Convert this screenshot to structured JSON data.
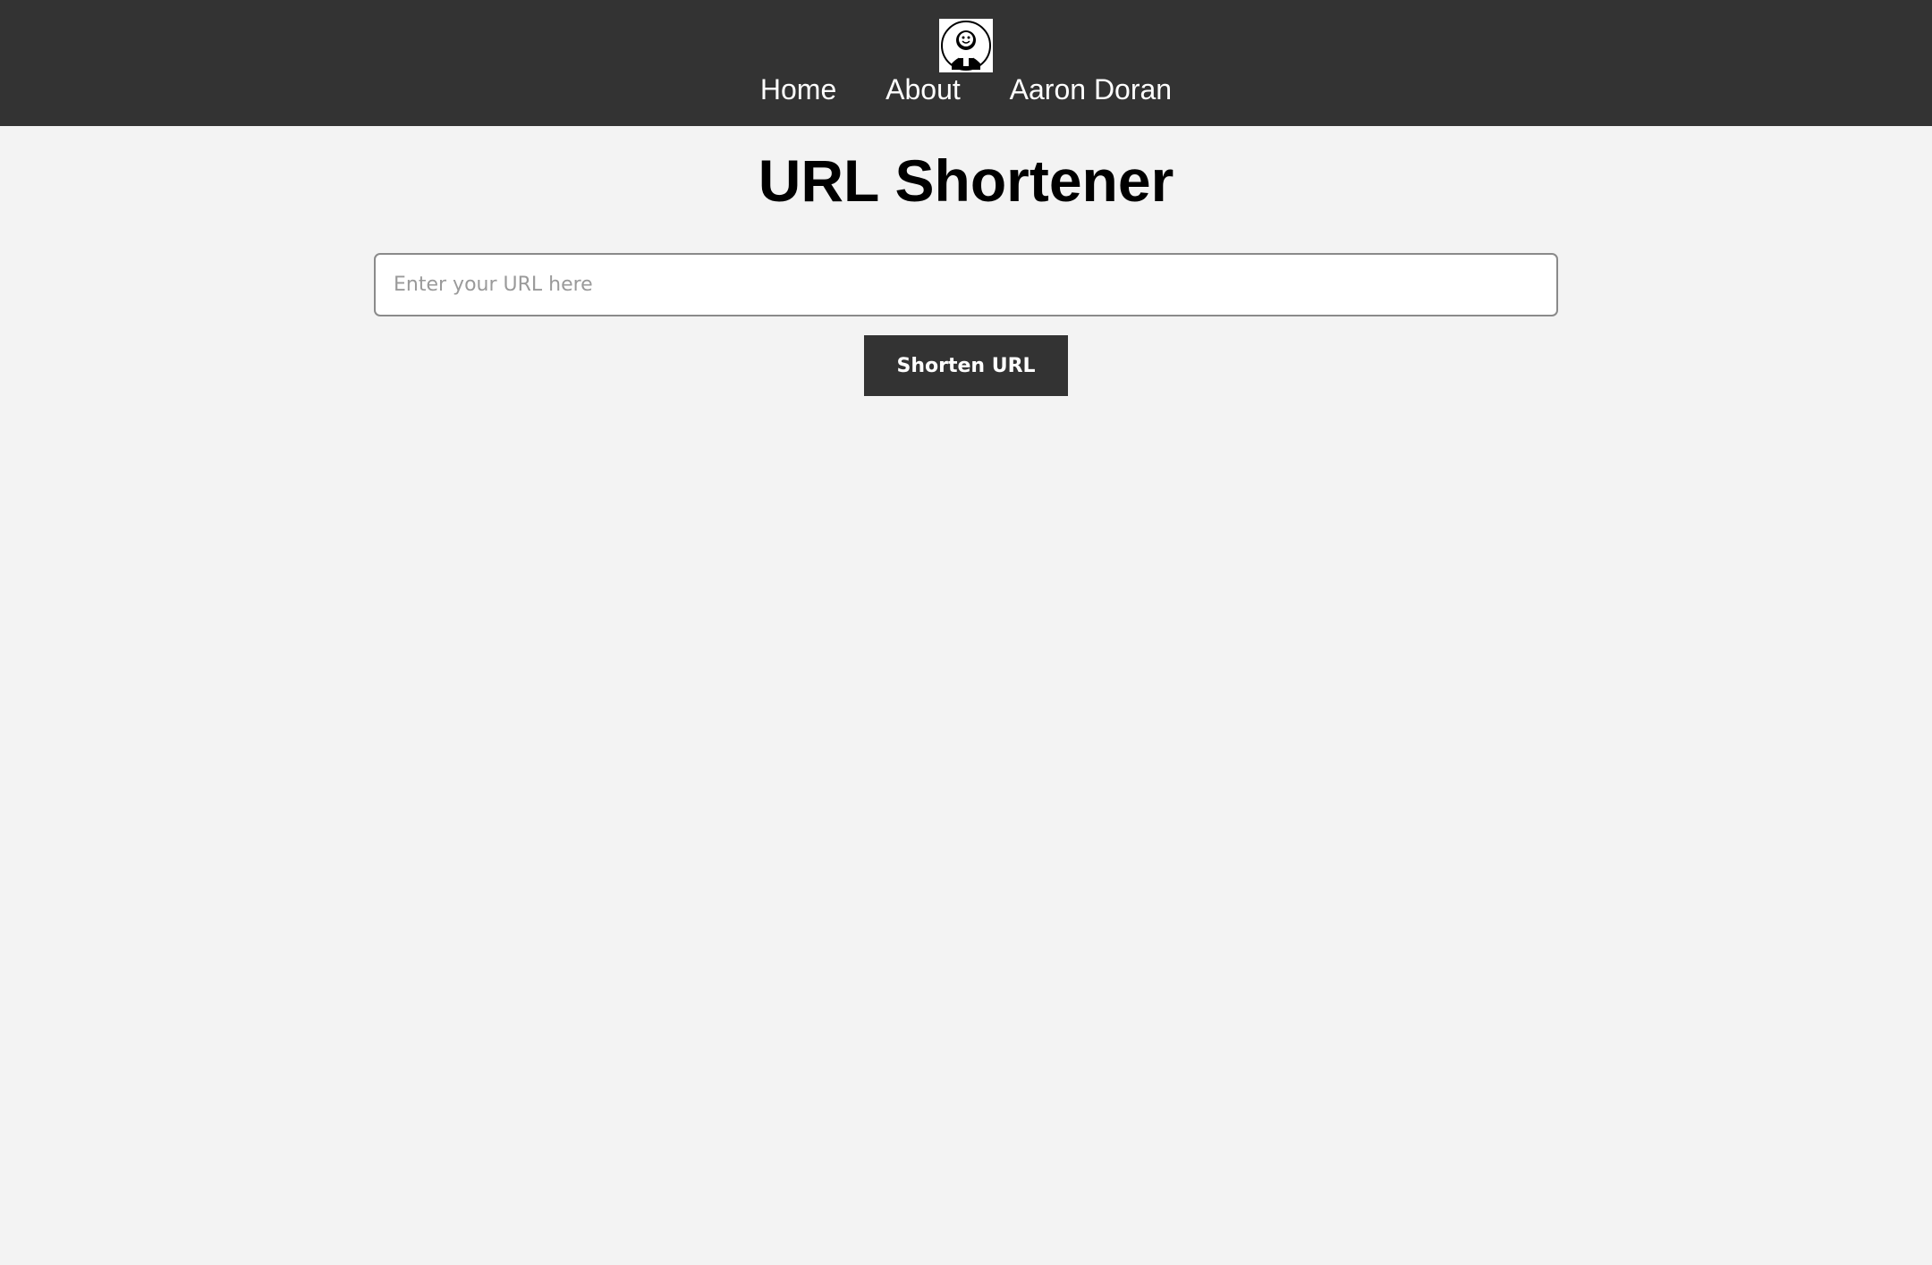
{
  "nav": {
    "logo_icon": "smiley-avatar-icon",
    "items": [
      {
        "label": "Home"
      },
      {
        "label": "About"
      },
      {
        "label": "Aaron Doran"
      }
    ]
  },
  "main": {
    "title": "URL Shortener",
    "url_input": {
      "placeholder": "Enter your URL here",
      "value": ""
    },
    "shorten_button_label": "Shorten URL"
  },
  "colors": {
    "header_bg": "#333333",
    "page_bg": "#f3f3f3",
    "button_bg": "#333333",
    "button_text": "#ffffff"
  }
}
